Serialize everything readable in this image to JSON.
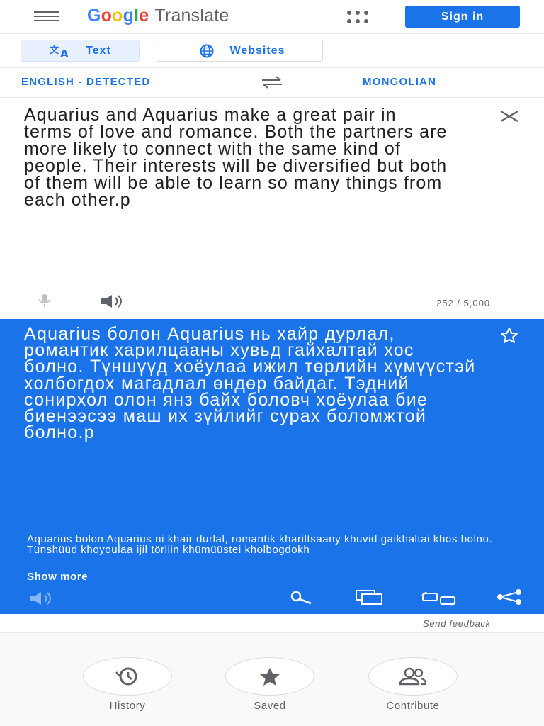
{
  "header": {
    "logo_google": [
      "G",
      "o",
      "o",
      "g",
      "l",
      "e"
    ],
    "logo_translate": "Translate",
    "sign_in": "Sign in"
  },
  "modes": {
    "text": "Text",
    "websites": "Websites"
  },
  "languages": {
    "source": "ENGLISH - DETECTED",
    "target": "MONGOLIAN"
  },
  "source": {
    "text": "Aquarius and Aquarius make a great pair in terms of love and romance. Both the partners are more likely to connect with the same kind of people. Their interests will be diversified but both of them will be able to learn so many things from each other.p",
    "char_count": "252 / 5,000"
  },
  "target": {
    "text": "Aquarius болон Aquarius нь хайр дурлал, романтик харилцааны хувьд гайхалтай хос болно. Түншүүд хоёулаа ижил төрлийн хүмүүстэй холбогдох магадлал өндөр байдаг. Тэдний сонирхол олон янз байх боловч хоёулаа бие биенээсээ маш их зүйлийг сурах боломжтой болно.p",
    "transliteration": "Aquarius bolon Aquarius ni khair durlal, romantik khariltsaany khuvid gaikhaltai khos bolno. Tünshüüd khoyoulaa ijil törliin khümüüstei kholbogdokh",
    "show_more": "Show more"
  },
  "feedback": "Send feedback",
  "bottom_nav": {
    "history": "History",
    "saved": "Saved",
    "contribute": "Contribute"
  },
  "colors": {
    "accent": "#1a73e8",
    "google_blue": "#4285f4",
    "google_red": "#ea4335",
    "google_yellow": "#fbbc05",
    "google_green": "#34a853"
  },
  "icons": [
    "menu-icon",
    "apps-icon",
    "translate-icon",
    "globe-icon",
    "swap-icon",
    "close-icon",
    "mic-icon",
    "speaker-icon",
    "star-icon",
    "search-icon",
    "copy-icon",
    "feedback-icon",
    "share-icon",
    "history-icon",
    "saved-star-icon",
    "contribute-icon"
  ]
}
